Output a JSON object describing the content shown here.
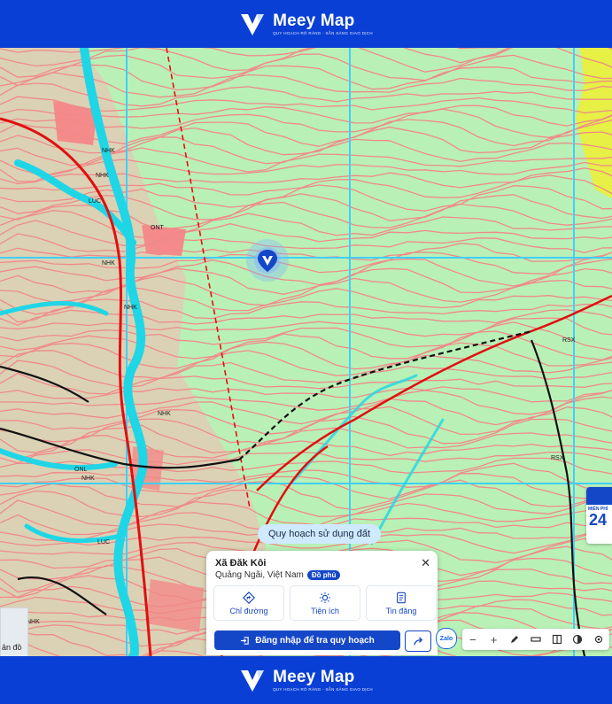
{
  "brand": {
    "name": "Meey Map",
    "tagline": "QUY HOẠCH RÕ RÀNG - SẴN SÀNG GIAO DỊCH"
  },
  "map": {
    "labels": [
      "NHK",
      "NHK",
      "NHK",
      "NHK",
      "NHK",
      "LUC",
      "ONL",
      "NHK",
      "RSX",
      "RSX",
      "LUC",
      "NHK",
      "ONT"
    ]
  },
  "chip": {
    "label": "Quy hoạch sử dụng đất"
  },
  "ad": {
    "label": "MIỄN PHÍ",
    "number": "24"
  },
  "place_panel": {
    "title": "Xã Đăk Kôi",
    "subtitle": "Quảng Ngãi, Việt Nam",
    "badge": "Đồ phủ",
    "actions": [
      {
        "label": "Chỉ đường",
        "icon": "directions-icon"
      },
      {
        "label": "Tiện ích",
        "icon": "utilities-icon"
      },
      {
        "label": "Tin đăng",
        "icon": "listing-icon"
      }
    ],
    "cta": "Đăng nhập để tra quy hoạch"
  },
  "zalo": {
    "label": "Zalo"
  },
  "toolbar": {
    "zoom_out": "−",
    "zoom_in": "+"
  },
  "minimap": {
    "label": "ản đồ"
  },
  "colors": {
    "brand_blue": "#0a3fd6",
    "map_bg": "#b9f0b6",
    "contour": "#f08a8a",
    "water": "#20d8e8",
    "road": "#e01010",
    "grid": "#3fd0ff"
  }
}
